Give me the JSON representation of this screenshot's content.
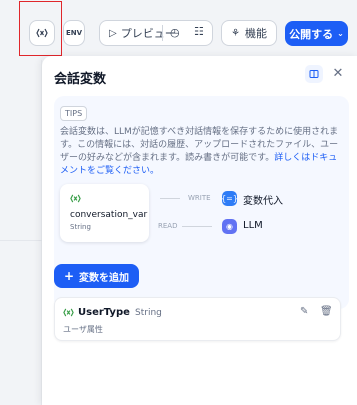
{
  "toolbar": {
    "env_label": "ENV",
    "preview_label": "プレビュー",
    "features_label": "機能",
    "publish_label": "公開する"
  },
  "panel": {
    "title": "会話変数"
  },
  "tips": {
    "badge": "TIPS",
    "text": "会話変数は、LLMが記憶すべき対話情報を保存するために使用されます。この情報には、対話の履歴、アップロードされたファイル、ユーザーの好みなどが含まれます。読み書きが可能です。",
    "link": "詳しくはドキュメントをご覧ください。"
  },
  "diagram": {
    "var_name": "conversation_var",
    "var_type": "String",
    "write_label": "WRITE",
    "read_label": "READ",
    "write_target": "変数代入",
    "read_target": "LLM"
  },
  "add_button": {
    "label": "変数を追加"
  },
  "variable": {
    "name": "UserType",
    "type": "String",
    "description": "ユーザ属性"
  },
  "colors": {
    "primary": "#1d5ef5",
    "green_icon": "#3a9e49",
    "highlight": "#e0262b"
  }
}
